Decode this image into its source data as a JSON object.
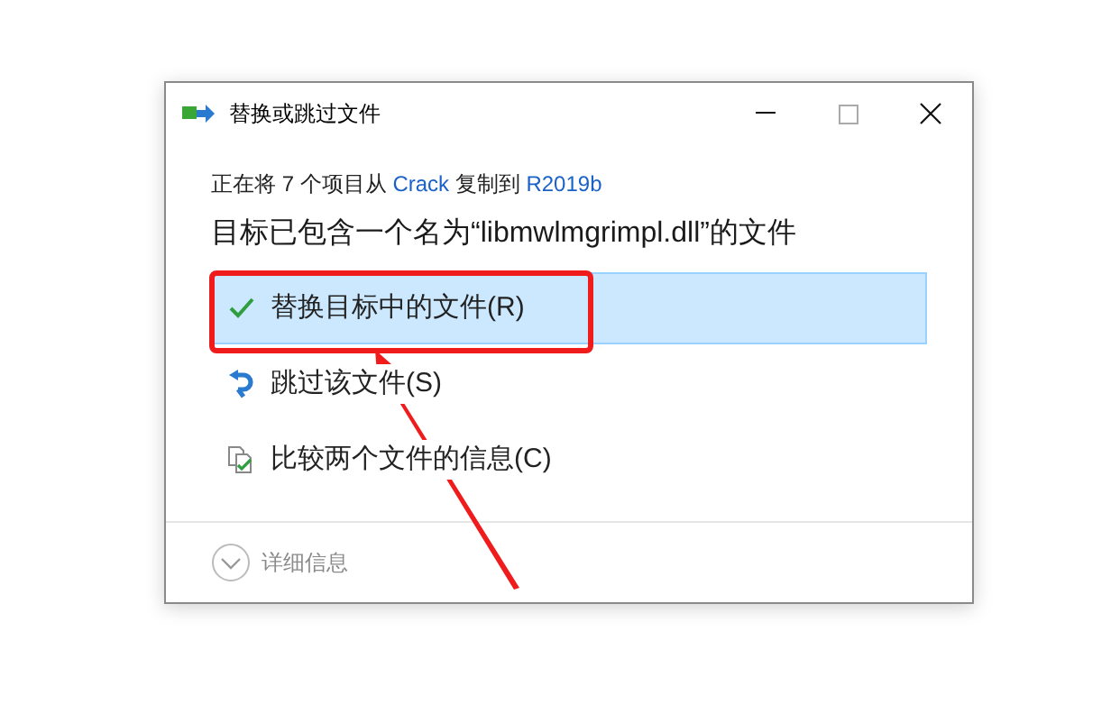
{
  "window": {
    "title": "替换或跳过文件"
  },
  "copy_status": [
    {
      "kind": "text",
      "text": "正在将 7 个项目从 "
    },
    {
      "kind": "link",
      "text": "Crack"
    },
    {
      "kind": "text",
      "text": " 复制到 "
    },
    {
      "kind": "link",
      "text": "R2019b"
    }
  ],
  "heading": "目标已包含一个名为“libmwlmgrimpl.dll”的文件",
  "options": [
    {
      "kind": "replace",
      "label": "替换目标中的文件(R)",
      "selected": true
    },
    {
      "kind": "skip",
      "label": "跳过该文件(S)",
      "selected": false
    },
    {
      "kind": "compare",
      "label": "比较两个文件的信息(C)",
      "selected": false
    }
  ],
  "details": {
    "label": "详细信息",
    "expanded": false
  }
}
